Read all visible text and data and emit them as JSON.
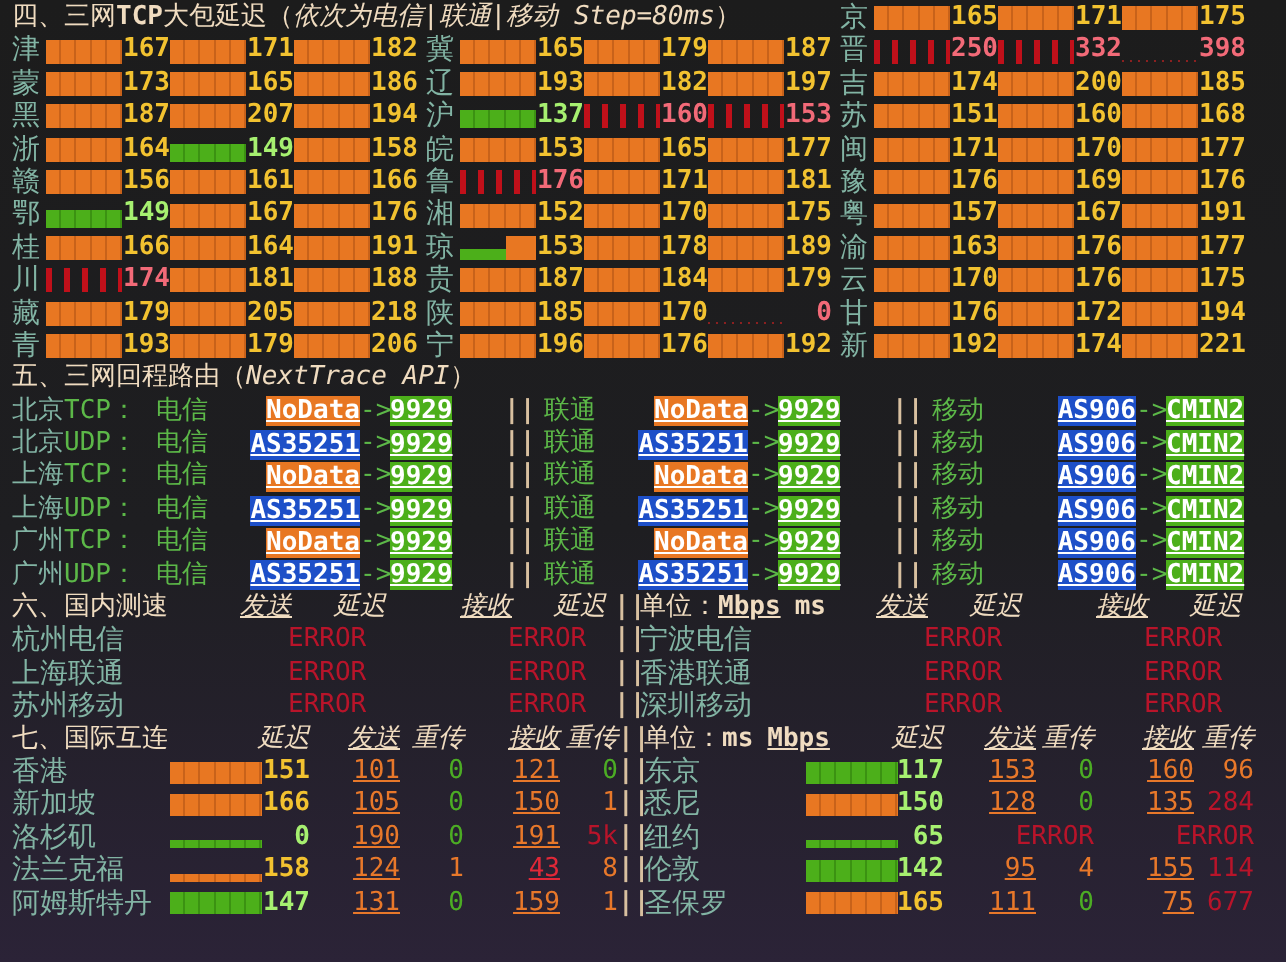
{
  "latency": {
    "title": "四、三网**TCP**大包延迟（*依次为电信|联通|移动 Step=80ms*）",
    "columns": [
      [
        {
          "region": "津",
          "results": [
            {
              "value": "167",
              "kind": "normal"
            },
            {
              "value": "171",
              "kind": "normal"
            },
            {
              "value": "182",
              "kind": "normal"
            }
          ]
        },
        {
          "region": "蒙",
          "results": [
            {
              "value": "173",
              "kind": "normal"
            },
            {
              "value": "165",
              "kind": "normal"
            },
            {
              "value": "186",
              "kind": "normal"
            }
          ]
        },
        {
          "region": "黑",
          "results": [
            {
              "value": "187",
              "kind": "normal"
            },
            {
              "value": "207",
              "kind": "normal"
            },
            {
              "value": "194",
              "kind": "normal"
            }
          ]
        },
        {
          "region": "浙",
          "results": [
            {
              "value": "164",
              "kind": "normal"
            },
            {
              "value": "149",
              "kind": "good"
            },
            {
              "value": "158",
              "kind": "normal"
            }
          ]
        },
        {
          "region": "赣",
          "results": [
            {
              "value": "156",
              "kind": "normal"
            },
            {
              "value": "161",
              "kind": "normal"
            },
            {
              "value": "166",
              "kind": "normal"
            }
          ]
        },
        {
          "region": "鄂",
          "results": [
            {
              "value": "149",
              "kind": "good"
            },
            {
              "value": "167",
              "kind": "normal"
            },
            {
              "value": "176",
              "kind": "normal"
            }
          ]
        },
        {
          "region": "桂",
          "results": [
            {
              "value": "166",
              "kind": "normal"
            },
            {
              "value": "164",
              "kind": "normal"
            },
            {
              "value": "191",
              "kind": "normal"
            }
          ]
        },
        {
          "region": "川",
          "results": [
            {
              "value": "174",
              "kind": "bad"
            },
            {
              "value": "181",
              "kind": "normal"
            },
            {
              "value": "188",
              "kind": "normal"
            }
          ]
        },
        {
          "region": "藏",
          "results": [
            {
              "value": "179",
              "kind": "normal"
            },
            {
              "value": "205",
              "kind": "normal"
            },
            {
              "value": "218",
              "kind": "normal"
            }
          ]
        },
        {
          "region": "青",
          "results": [
            {
              "value": "193",
              "kind": "normal"
            },
            {
              "value": "179",
              "kind": "normal"
            },
            {
              "value": "206",
              "kind": "normal"
            }
          ]
        }
      ],
      [
        {
          "region": "冀",
          "results": [
            {
              "value": "165",
              "kind": "normal"
            },
            {
              "value": "179",
              "kind": "normal"
            },
            {
              "value": "187",
              "kind": "normal"
            }
          ]
        },
        {
          "region": "辽",
          "results": [
            {
              "value": "193",
              "kind": "normal"
            },
            {
              "value": "182",
              "kind": "normal"
            },
            {
              "value": "197",
              "kind": "normal"
            }
          ]
        },
        {
          "region": "沪",
          "results": [
            {
              "value": "137",
              "kind": "good"
            },
            {
              "value": "160",
              "kind": "bad"
            },
            {
              "value": "153",
              "kind": "bad"
            }
          ]
        },
        {
          "region": "皖",
          "results": [
            {
              "value": "153",
              "kind": "normal"
            },
            {
              "value": "165",
              "kind": "normal"
            },
            {
              "value": "177",
              "kind": "normal"
            }
          ]
        },
        {
          "region": "鲁",
          "results": [
            {
              "value": "176",
              "kind": "bad"
            },
            {
              "value": "171",
              "kind": "normal"
            },
            {
              "value": "181",
              "kind": "normal"
            }
          ]
        },
        {
          "region": "湘",
          "results": [
            {
              "value": "152",
              "kind": "normal"
            },
            {
              "value": "170",
              "kind": "normal"
            },
            {
              "value": "175",
              "kind": "normal"
            }
          ]
        },
        {
          "region": "琼",
          "results": [
            {
              "value": "153",
              "kind": "mixed"
            },
            {
              "value": "178",
              "kind": "normal"
            },
            {
              "value": "189",
              "kind": "normal"
            }
          ]
        },
        {
          "region": "贵",
          "results": [
            {
              "value": "187",
              "kind": "normal"
            },
            {
              "value": "184",
              "kind": "normal"
            },
            {
              "value": "179",
              "kind": "normal"
            }
          ]
        },
        {
          "region": "陕",
          "results": [
            {
              "value": "185",
              "kind": "normal"
            },
            {
              "value": "170",
              "kind": "normal"
            },
            {
              "value": "0",
              "kind": "lost"
            }
          ]
        },
        {
          "region": "宁",
          "results": [
            {
              "value": "196",
              "kind": "normal"
            },
            {
              "value": "176",
              "kind": "normal"
            },
            {
              "value": "192",
              "kind": "normal"
            }
          ]
        }
      ],
      [
        {
          "region": "京",
          "results": [
            {
              "value": "165",
              "kind": "normal"
            },
            {
              "value": "171",
              "kind": "normal"
            },
            {
              "value": "175",
              "kind": "normal"
            }
          ]
        },
        {
          "region": "晋",
          "results": [
            {
              "value": "250",
              "kind": "bad"
            },
            {
              "value": "332",
              "kind": "bad"
            },
            {
              "value": "398",
              "kind": "lost"
            }
          ]
        },
        {
          "region": "吉",
          "results": [
            {
              "value": "174",
              "kind": "normal"
            },
            {
              "value": "200",
              "kind": "normal"
            },
            {
              "value": "185",
              "kind": "normal"
            }
          ]
        },
        {
          "region": "苏",
          "results": [
            {
              "value": "151",
              "kind": "normal"
            },
            {
              "value": "160",
              "kind": "normal"
            },
            {
              "value": "168",
              "kind": "normal"
            }
          ]
        },
        {
          "region": "闽",
          "results": [
            {
              "value": "171",
              "kind": "normal"
            },
            {
              "value": "170",
              "kind": "normal"
            },
            {
              "value": "177",
              "kind": "normal"
            }
          ]
        },
        {
          "region": "豫",
          "results": [
            {
              "value": "176",
              "kind": "normal"
            },
            {
              "value": "169",
              "kind": "normal"
            },
            {
              "value": "176",
              "kind": "normal"
            }
          ]
        },
        {
          "region": "粤",
          "results": [
            {
              "value": "157",
              "kind": "normal"
            },
            {
              "value": "167",
              "kind": "normal"
            },
            {
              "value": "191",
              "kind": "normal"
            }
          ]
        },
        {
          "region": "渝",
          "results": [
            {
              "value": "163",
              "kind": "normal"
            },
            {
              "value": "176",
              "kind": "normal"
            },
            {
              "value": "177",
              "kind": "normal"
            }
          ]
        },
        {
          "region": "云",
          "results": [
            {
              "value": "170",
              "kind": "normal"
            },
            {
              "value": "176",
              "kind": "normal"
            },
            {
              "value": "175",
              "kind": "normal"
            }
          ]
        },
        {
          "region": "甘",
          "results": [
            {
              "value": "176",
              "kind": "normal"
            },
            {
              "value": "172",
              "kind": "normal"
            },
            {
              "value": "194",
              "kind": "normal"
            }
          ]
        },
        {
          "region": "新",
          "results": [
            {
              "value": "192",
              "kind": "normal"
            },
            {
              "value": "174",
              "kind": "normal"
            },
            {
              "value": "221",
              "kind": "normal"
            }
          ]
        }
      ]
    ]
  },
  "routes": {
    "title": "五、三网回程路由（*NextTrace API*）",
    "rows": [
      {
        "city": "北京",
        "proto": "TCP：",
        "paths": [
          {
            "isp": "电信",
            "src": {
              "text": "NoData",
              "color": "#e87722"
            },
            "arrow": "->",
            "dst": {
              "text": "9929",
              "color": "#4caf1a"
            }
          },
          {
            "divider": "||",
            "isp": "联通",
            "src": {
              "text": "NoData",
              "color": "#e87722"
            },
            "arrow": "->",
            "dst": {
              "text": "9929",
              "color": "#4caf1a"
            }
          },
          {
            "divider": "||",
            "isp": "移动",
            "src": {
              "text": "AS906",
              "color": "#1d4fc8"
            },
            "arrow": "->",
            "dst": {
              "text": "CMIN2",
              "color": "#4caf1a"
            }
          }
        ]
      },
      {
        "city": "北京",
        "proto": "UDP：",
        "paths": [
          {
            "isp": "电信",
            "src": {
              "text": "AS35251",
              "color": "#1d4fc8"
            },
            "arrow": "->",
            "dst": {
              "text": "9929",
              "color": "#4caf1a"
            }
          },
          {
            "divider": "||",
            "isp": "联通",
            "src": {
              "text": "AS35251",
              "color": "#1d4fc8"
            },
            "arrow": "->",
            "dst": {
              "text": "9929",
              "color": "#4caf1a"
            }
          },
          {
            "divider": "||",
            "isp": "移动",
            "src": {
              "text": "AS906",
              "color": "#1d4fc8"
            },
            "arrow": "->",
            "dst": {
              "text": "CMIN2",
              "color": "#4caf1a"
            }
          }
        ]
      },
      {
        "city": "上海",
        "proto": "TCP：",
        "paths": [
          {
            "isp": "电信",
            "src": {
              "text": "NoData",
              "color": "#e87722"
            },
            "arrow": "->",
            "dst": {
              "text": "9929",
              "color": "#4caf1a"
            }
          },
          {
            "divider": "||",
            "isp": "联通",
            "src": {
              "text": "NoData",
              "color": "#e87722"
            },
            "arrow": "->",
            "dst": {
              "text": "9929",
              "color": "#4caf1a"
            }
          },
          {
            "divider": "||",
            "isp": "移动",
            "src": {
              "text": "AS906",
              "color": "#1d4fc8"
            },
            "arrow": "->",
            "dst": {
              "text": "CMIN2",
              "color": "#4caf1a"
            }
          }
        ]
      },
      {
        "city": "上海",
        "proto": "UDP：",
        "paths": [
          {
            "isp": "电信",
            "src": {
              "text": "AS35251",
              "color": "#1d4fc8"
            },
            "arrow": "->",
            "dst": {
              "text": "9929",
              "color": "#4caf1a"
            }
          },
          {
            "divider": "||",
            "isp": "联通",
            "src": {
              "text": "AS35251",
              "color": "#1d4fc8"
            },
            "arrow": "->",
            "dst": {
              "text": "9929",
              "color": "#4caf1a"
            }
          },
          {
            "divider": "||",
            "isp": "移动",
            "src": {
              "text": "AS906",
              "color": "#1d4fc8"
            },
            "arrow": "->",
            "dst": {
              "text": "CMIN2",
              "color": "#4caf1a"
            }
          }
        ]
      },
      {
        "city": "广州",
        "proto": "TCP：",
        "paths": [
          {
            "isp": "电信",
            "src": {
              "text": "NoData",
              "color": "#e87722"
            },
            "arrow": "->",
            "dst": {
              "text": "9929",
              "color": "#4caf1a"
            }
          },
          {
            "divider": "||",
            "isp": "联通",
            "src": {
              "text": "NoData",
              "color": "#e87722"
            },
            "arrow": "->",
            "dst": {
              "text": "9929",
              "color": "#4caf1a"
            }
          },
          {
            "divider": "||",
            "isp": "移动",
            "src": {
              "text": "AS906",
              "color": "#1d4fc8"
            },
            "arrow": "->",
            "dst": {
              "text": "CMIN2",
              "color": "#4caf1a"
            }
          }
        ]
      },
      {
        "city": "广州",
        "proto": "UDP：",
        "paths": [
          {
            "isp": "电信",
            "src": {
              "text": "AS35251",
              "color": "#1d4fc8"
            },
            "arrow": "->",
            "dst": {
              "text": "9929",
              "color": "#4caf1a"
            }
          },
          {
            "divider": "||",
            "isp": "联通",
            "src": {
              "text": "AS35251",
              "color": "#1d4fc8"
            },
            "arrow": "->",
            "dst": {
              "text": "9929",
              "color": "#4caf1a"
            }
          },
          {
            "divider": "||",
            "isp": "移动",
            "src": {
              "text": "AS906",
              "color": "#1d4fc8"
            },
            "arrow": "->",
            "dst": {
              "text": "CMIN2",
              "color": "#4caf1a"
            }
          }
        ]
      }
    ]
  },
  "domestic": {
    "title": "六、国内测速",
    "divider": "||",
    "left_headers": [
      {
        "text": "发送",
        "underlined": true
      },
      {
        "text": "延迟",
        "underlined": false
      },
      {
        "text": "接收",
        "underlined": true
      },
      {
        "text": "延迟",
        "underlined": false
      }
    ],
    "unit_label": "单位：",
    "units": [
      {
        "text": "Mbps",
        "underlined": true
      },
      {
        "text": "ms",
        "underlined": false
      }
    ],
    "right_headers": [
      {
        "text": "发送",
        "underlined": true
      },
      {
        "text": "延迟",
        "underlined": false
      },
      {
        "text": "接收",
        "underlined": true
      },
      {
        "text": "延迟",
        "underlined": false
      }
    ],
    "rows": [
      {
        "divider": "||",
        "left": {
          "name": "杭州电信",
          "results": [
            "ERROR",
            "ERROR"
          ]
        },
        "right": {
          "name": "宁波电信",
          "results": [
            "ERROR",
            "ERROR"
          ]
        }
      },
      {
        "divider": "||",
        "left": {
          "name": "上海联通",
          "results": [
            "ERROR",
            "ERROR"
          ]
        },
        "right": {
          "name": "香港联通",
          "results": [
            "ERROR",
            "ERROR"
          ]
        }
      },
      {
        "divider": "||",
        "left": {
          "name": "苏州移动",
          "results": [
            "ERROR",
            "ERROR"
          ]
        },
        "right": {
          "name": "深圳移动",
          "results": [
            "ERROR",
            "ERROR"
          ]
        }
      }
    ]
  },
  "international": {
    "title": "七、国际互连",
    "divider": "||",
    "headers": [
      {
        "text": "延迟",
        "underlined": false
      },
      {
        "text": "发送",
        "underlined": true
      },
      {
        "text": "重传",
        "underlined": false
      },
      {
        "text": "接收",
        "underlined": true
      },
      {
        "text": "重传",
        "underlined": false
      }
    ],
    "unit_label": "单位：",
    "units": [
      {
        "text": "ms",
        "underlined": false
      },
      {
        "text": "Mbps",
        "underlined": true
      }
    ],
    "right_headers": [
      {
        "text": "延迟",
        "underlined": false
      },
      {
        "text": "发送",
        "underlined": true
      },
      {
        "text": "重传",
        "underlined": false
      },
      {
        "text": "接收",
        "underlined": true
      },
      {
        "text": "重传",
        "underlined": false
      }
    ],
    "rows": [
      {
        "divider": "||",
        "left": {
          "name": "香港",
          "bar": {
            "kind": "warn",
            "thin": false
          },
          "latency": {
            "value": "151",
            "kind": "normal"
          },
          "transfers": [
            {
              "kind": "ok",
              "rate": {
                "value": "101",
                "kind": "warn"
              },
              "retrans": {
                "value": "0",
                "kind": "good"
              }
            },
            {
              "kind": "ok",
              "rate": {
                "value": "121",
                "kind": "warn"
              },
              "retrans": {
                "value": "0",
                "kind": "good"
              }
            }
          ]
        },
        "right": {
          "name": "东京",
          "bar": {
            "kind": "good",
            "thin": false
          },
          "latency": {
            "value": "117",
            "kind": "good"
          },
          "transfers": [
            {
              "kind": "ok",
              "rate": {
                "value": "153",
                "kind": "warn"
              },
              "retrans": {
                "value": "0",
                "kind": "good"
              }
            },
            {
              "kind": "ok",
              "rate": {
                "value": "160",
                "kind": "warn"
              },
              "retrans": {
                "value": "96",
                "kind": "warn"
              }
            }
          ]
        }
      },
      {
        "divider": "||",
        "left": {
          "name": "新加坡",
          "bar": {
            "kind": "warn",
            "thin": false
          },
          "latency": {
            "value": "166",
            "kind": "normal"
          },
          "transfers": [
            {
              "kind": "ok",
              "rate": {
                "value": "105",
                "kind": "warn"
              },
              "retrans": {
                "value": "0",
                "kind": "good"
              }
            },
            {
              "kind": "ok",
              "rate": {
                "value": "150",
                "kind": "warn"
              },
              "retrans": {
                "value": "1",
                "kind": "warn"
              }
            }
          ]
        },
        "right": {
          "name": "悉尼",
          "bar": {
            "kind": "warn",
            "thin": false
          },
          "latency": {
            "value": "150",
            "kind": "good"
          },
          "transfers": [
            {
              "kind": "ok",
              "rate": {
                "value": "128",
                "kind": "warn"
              },
              "retrans": {
                "value": "0",
                "kind": "good"
              }
            },
            {
              "kind": "ok",
              "rate": {
                "value": "135",
                "kind": "warn"
              },
              "retrans": {
                "value": "284",
                "kind": "bad"
              }
            }
          ]
        }
      },
      {
        "divider": "||",
        "left": {
          "name": "洛杉矶",
          "bar": {
            "kind": "good",
            "thin": true
          },
          "latency": {
            "value": "0",
            "kind": "good"
          },
          "transfers": [
            {
              "kind": "ok",
              "rate": {
                "value": "190",
                "kind": "warn"
              },
              "retrans": {
                "value": "0",
                "kind": "good"
              }
            },
            {
              "kind": "ok",
              "rate": {
                "value": "191",
                "kind": "warn"
              },
              "retrans": {
                "value": "5k",
                "kind": "bad"
              }
            }
          ]
        },
        "right": {
          "name": "纽约",
          "bar": {
            "kind": "good",
            "thin": true
          },
          "latency": {
            "value": "65",
            "kind": "good"
          },
          "transfers": [
            {
              "kind": "error",
              "text": "ERROR"
            },
            {
              "kind": "error",
              "text": "ERROR"
            }
          ]
        }
      },
      {
        "divider": "||",
        "left": {
          "name": "法兰克福",
          "bar": {
            "kind": "warn",
            "thin": true
          },
          "latency": {
            "value": "158",
            "kind": "normal"
          },
          "transfers": [
            {
              "kind": "ok",
              "rate": {
                "value": "124",
                "kind": "warn"
              },
              "retrans": {
                "value": "1",
                "kind": "warn"
              }
            },
            {
              "kind": "ok",
              "rate": {
                "value": "43",
                "kind": "bad"
              },
              "retrans": {
                "value": "8",
                "kind": "warn"
              }
            }
          ]
        },
        "right": {
          "name": "伦敦",
          "bar": {
            "kind": "good",
            "thin": false
          },
          "latency": {
            "value": "142",
            "kind": "good"
          },
          "transfers": [
            {
              "kind": "ok",
              "rate": {
                "value": "95",
                "kind": "warn"
              },
              "retrans": {
                "value": "4",
                "kind": "warn"
              }
            },
            {
              "kind": "ok",
              "rate": {
                "value": "155",
                "kind": "warn"
              },
              "retrans": {
                "value": "114",
                "kind": "bad"
              }
            }
          ]
        }
      },
      {
        "divider": "||",
        "left": {
          "name": "阿姆斯特丹",
          "bar": {
            "kind": "good",
            "thin": false
          },
          "latency": {
            "value": "147",
            "kind": "good"
          },
          "transfers": [
            {
              "kind": "ok",
              "rate": {
                "value": "131",
                "kind": "warn"
              },
              "retrans": {
                "value": "0",
                "kind": "good"
              }
            },
            {
              "kind": "ok",
              "rate": {
                "value": "159",
                "kind": "warn"
              },
              "retrans": {
                "value": "1",
                "kind": "warn"
              }
            }
          ]
        },
        "right": {
          "name": "圣保罗",
          "bar": {
            "kind": "warn",
            "thin": false
          },
          "latency": {
            "value": "165",
            "kind": "normal"
          },
          "transfers": [
            {
              "kind": "ok",
              "rate": {
                "value": "111",
                "kind": "warn"
              },
              "retrans": {
                "value": "0",
                "kind": "good"
              }
            },
            {
              "kind": "ok",
              "rate": {
                "value": "75",
                "kind": "warn"
              },
              "retrans": {
                "value": "677",
                "kind": "bad"
              }
            }
          ]
        }
      }
    ]
  }
}
